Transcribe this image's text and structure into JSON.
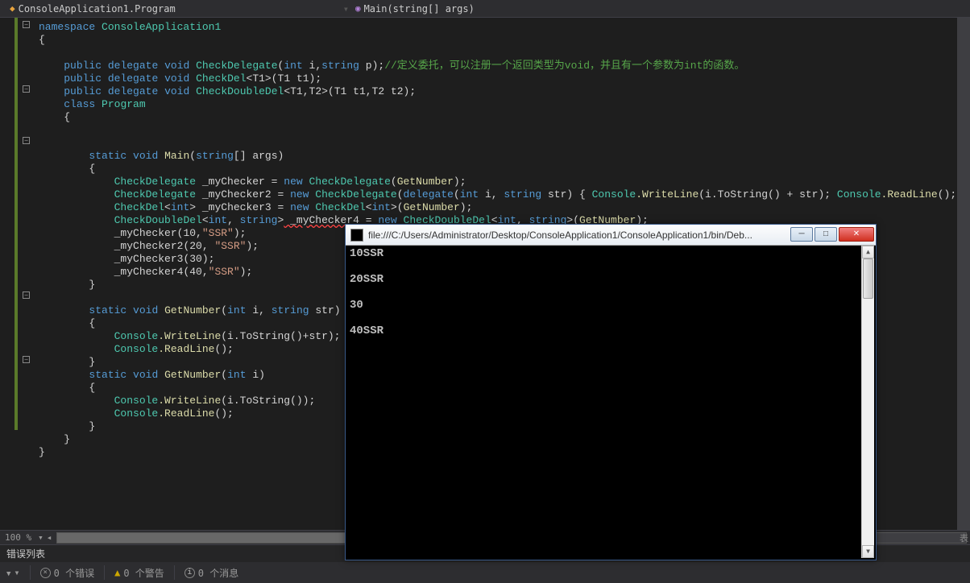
{
  "breadcrumb": {
    "namespace": "ConsoleApplication1.Program",
    "member": "Main(string[] args)"
  },
  "code": {
    "l1_kw1": "namespace",
    "l1_ns": " ConsoleApplication1",
    "l2": "{",
    "l4_pub": "public",
    "l4_del": "delegate",
    "l4_void": "void",
    "l4_name": "CheckDelegate",
    "l4_p1t": "int",
    "l4_p1n": " i,",
    "l4_p2t": "string",
    "l4_p2n": " p",
    "l4_end": ");",
    "l4_com": "//定义委托，可以注册一个返回类型为void，并且有一个参数为int的函数。",
    "l5_pub": "public",
    "l5_del": "delegate",
    "l5_void": "void",
    "l5_name": "CheckDel",
    "l5_gen": "<T1>",
    "l5_params": "(T1 t1);",
    "l6_pub": "public",
    "l6_del": "delegate",
    "l6_void": "void",
    "l6_name": "CheckDoubleDel",
    "l6_gen": "<T1,T2>",
    "l6_params": "(T1 t1,T2 t2);",
    "l7_kw": "class",
    "l7_name": "Program",
    "l8": "{",
    "l11_kw1": "static",
    "l11_kw2": "void",
    "l11_name": "Main",
    "l11_p1t": "string",
    "l11_p1a": "[]",
    "l11_p1n": " args",
    "l12": "{",
    "l13_t": "CheckDelegate",
    "l13_v": " _myChecker = ",
    "l13_new": "new",
    "l13_t2": " CheckDelegate",
    "l13_fn": "GetNumber",
    "l14_t": "CheckDelegate",
    "l14_v": " _myChecker2 = ",
    "l14_new": "new",
    "l14_t2": " CheckDelegate",
    "l14_del": "delegate",
    "l14_pt1": "int",
    "l14_pn1": " i, ",
    "l14_pt2": "string",
    "l14_pn2": " str",
    "l14_body1": ") { ",
    "l14_cons": "Console",
    "l14_wl": ".WriteLine",
    "l14_its": "(i.ToString",
    "l14_plus": "() + str); ",
    "l14_cons2": "Console",
    "l14_rl": ".ReadLine",
    "l14_end": "(); });",
    "l15_t": "CheckDel",
    "l15_g": "<",
    "l15_gt": "int",
    "l15_ge": ">",
    "l15_v": " _myChecker3 = ",
    "l15_new": "new",
    "l15_t2": " CheckDel",
    "l15_g2": "<",
    "l15_gt2": "int",
    "l15_ge2": ">",
    "l15_fn": "GetNumber",
    "l16_t": "CheckDoubleDel",
    "l16_g": "<",
    "l16_gt1": "int",
    "l16_gc": ", ",
    "l16_gt2": "string",
    "l16_ge": ">",
    "l16_v": " _myChecker4",
    "l16_eq": " = ",
    "l16_new": "new",
    "l16_t2": " CheckDoubleDel",
    "l16_g2": "<",
    "l16_g2t1": "int",
    "l16_g2c": ", ",
    "l16_g2t2": "string",
    "l16_g2e": ">",
    "l16_fn": "GetNumber",
    "l17": "_myChecker(10,",
    "l17_s": "\"SSR\"",
    "l17_e": ");",
    "l18": "_myChecker2(20, ",
    "l18_s": "\"SSR\"",
    "l18_e": ");",
    "l19": "_myChecker3(30);",
    "l20": "_myChecker4(40,",
    "l20_s": "\"SSR\"",
    "l20_e": ");",
    "l21": "}",
    "l23_kw1": "static",
    "l23_kw2": "void",
    "l23_name": "GetNumber",
    "l23_pt1": "int",
    "l23_pn1": " i, ",
    "l23_pt2": "string",
    "l23_pn2": " str",
    "l24": "{",
    "l25_c": "Console",
    "l25_wl": ".WriteLine",
    "l25_a": "(i.ToString",
    "l25_b": "()+str);",
    "l26_c": "Console",
    "l26_rl": ".ReadLine",
    "l26_e": "();",
    "l27": "}",
    "l28_kw1": "static",
    "l28_kw2": "void",
    "l28_name": "GetNumber",
    "l28_pt1": "int",
    "l28_pn1": " i",
    "l29": "{",
    "l30_c": "Console",
    "l30_wl": ".WriteLine",
    "l30_a": "(i.ToString",
    "l30_b": "());",
    "l31_c": "Console",
    "l31_rl": ".ReadLine",
    "l31_e": "();",
    "l32": "}",
    "l33": "}",
    "l34": "}"
  },
  "zoom": "100 %",
  "error_panel": {
    "title": "错误列表",
    "errors": "0 个错误",
    "warnings": "0 个警告",
    "messages": "0 个消息"
  },
  "console": {
    "title": "file:///C:/Users/Administrator/Desktop/ConsoleApplication1/ConsoleApplication1/bin/Deb...",
    "lines": [
      "10SSR",
      "",
      "20SSR",
      "",
      "30",
      "",
      "40SSR"
    ]
  },
  "char_right": "表"
}
